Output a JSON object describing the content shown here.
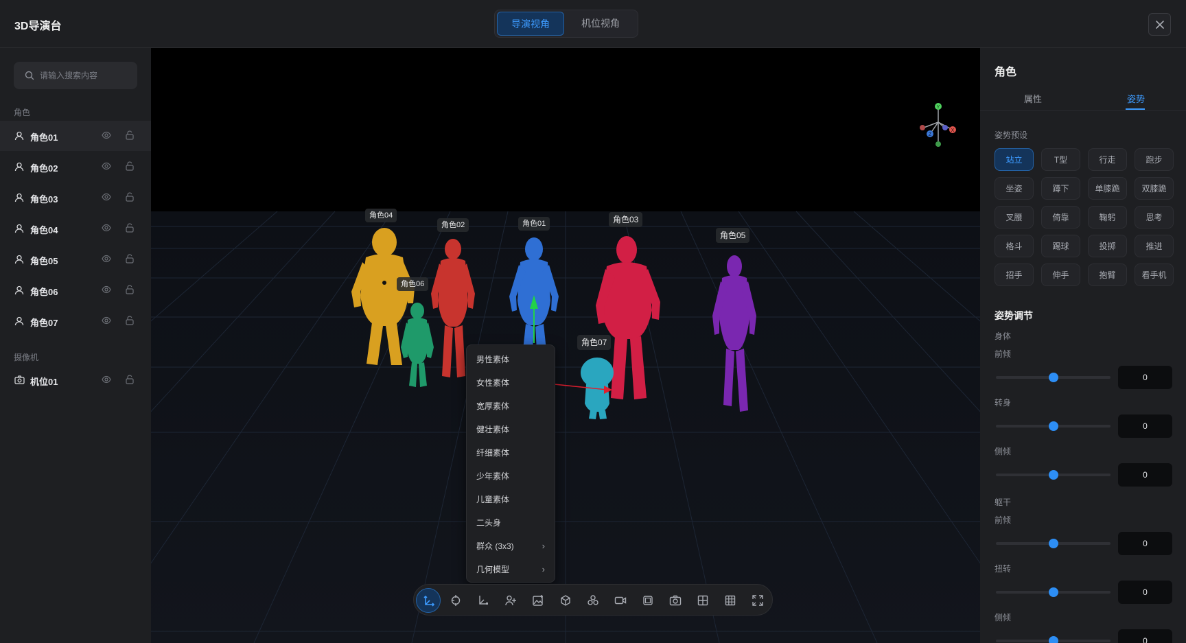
{
  "header": {
    "title": "3D导演台",
    "view_tabs": [
      "导演视角",
      "机位视角"
    ]
  },
  "sidebar": {
    "search_placeholder": "请输入搜索内容",
    "characters_label": "角色",
    "characters": [
      "角色01",
      "角色02",
      "角色03",
      "角色04",
      "角色05",
      "角色06",
      "角色07"
    ],
    "cameras_label": "摄像机",
    "cameras": [
      "机位01"
    ]
  },
  "viewport": {
    "axis_labels": [
      "Y",
      "X",
      "Z"
    ],
    "character_tags": [
      "角色04",
      "角色02",
      "角色01",
      "角色03",
      "角色05",
      "角色06",
      "角色07"
    ],
    "figure_colors": [
      "#d9a020",
      "#c8342e",
      "#2f6fd4",
      "#d21f45",
      "#7a27b0",
      "#1f9a6a",
      "#2aa6bf"
    ]
  },
  "context_menu": {
    "items": [
      "男性素体",
      "女性素体",
      "宽厚素体",
      "健壮素体",
      "纤细素体",
      "少年素体",
      "儿童素体",
      "二头身",
      "群众 (3x3)",
      "几何模型"
    ]
  },
  "toolbar": {
    "icons": [
      "move-icon",
      "rotate-icon",
      "scale-icon",
      "add-character-icon",
      "add-image-icon",
      "cube-icon",
      "group-icon",
      "video-camera-icon",
      "frame-icon",
      "camera-icon",
      "grid-2x2-icon",
      "grid-3x3-icon",
      "fullscreen-icon"
    ]
  },
  "right_panel": {
    "title": "角色",
    "tabs": [
      "属性",
      "姿势"
    ],
    "preset_label": "姿势预设",
    "presets": [
      "站立",
      "T型",
      "行走",
      "跑步",
      "坐姿",
      "蹲下",
      "单膝跪",
      "双膝跪",
      "叉腰",
      "倚靠",
      "鞠躬",
      "思考",
      "格斗",
      "踢球",
      "投掷",
      "推进",
      "招手",
      "伸手",
      "抱臂",
      "看手机"
    ],
    "adjust_title": "姿势调节",
    "body_label": "身体",
    "body_sliders": [
      {
        "label": "前倾",
        "value": "0"
      },
      {
        "label": "转身",
        "value": "0"
      },
      {
        "label": "侧倾",
        "value": "0"
      }
    ],
    "torso_label": "躯干",
    "torso_sliders": [
      {
        "label": "前倾",
        "value": "0"
      },
      {
        "label": "扭转",
        "value": "0"
      },
      {
        "label": "侧倾",
        "value": "0"
      }
    ],
    "accent": "#2d8ef5"
  }
}
